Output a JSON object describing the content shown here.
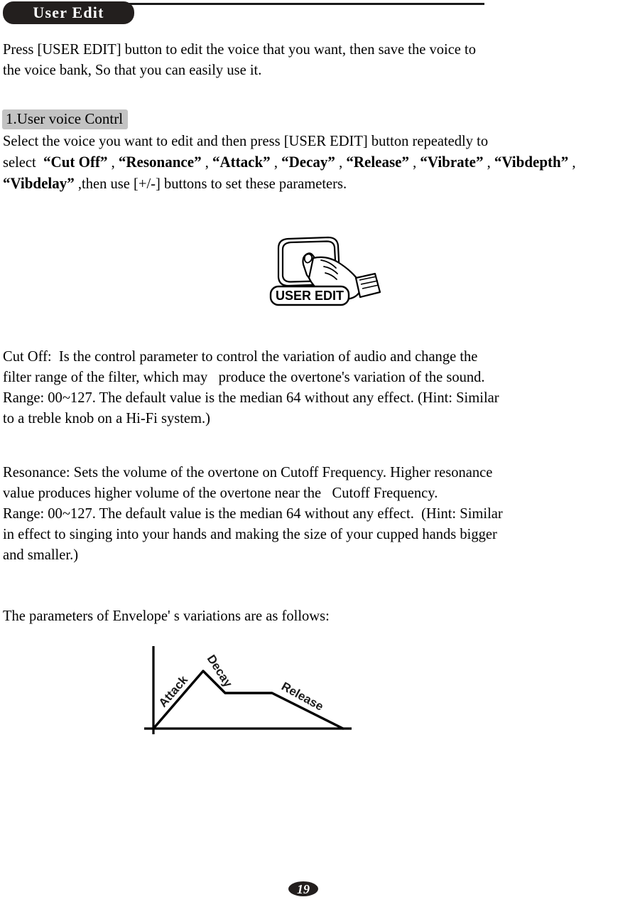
{
  "page": {
    "title_badge": "User Edit",
    "page_number": "19"
  },
  "intro": {
    "paragraph": "Press [USER EDIT] button to edit the voice that you want, then save the voice to\nthe voice bank, So that you can easily use it."
  },
  "section1": {
    "heading": "1.User voice Contrl",
    "line1": "Select the voice you want to edit and then press [USER EDIT] button repeatedly to",
    "line2_prefix": "select  ",
    "parameters": [
      "Cut Off",
      "Resonance",
      "Attack",
      "Decay",
      "Release",
      "Vibrate",
      "Vibdepth",
      "Vibdelay"
    ],
    "line3_suffix": ",then use [+/-] buttons to set these parameters.",
    "quote_open": "“",
    "quote_close": "”",
    "separator": " , "
  },
  "illustration": {
    "button_label": "USER EDIT",
    "alt": "hand pressing the USER EDIT button"
  },
  "cutoff": {
    "text": "Cut Off:  Is the control parameter to control the variation of audio and change the\nfilter range of the filter, which may   produce the overtone's variation of the sound.\nRange: 00~127. The default value is the median 64 without any effect. (Hint: Similar\nto a treble knob on a Hi-Fi system.)"
  },
  "resonance": {
    "text": "Resonance: Sets the volume of the overtone on Cutoff Frequency. Higher resonance\nvalue produces higher volume of the overtone near the   Cutoff Frequency.\nRange: 00~127. The default value is the median 64 without any effect.  (Hint: Similar\nin effect to singing into your hands and making the size of your cupped hands bigger\nand smaller.)"
  },
  "envelope": {
    "intro": "The parameters of Envelope' s variations are as follows:",
    "labels": {
      "attack": "Attack",
      "decay": "Decay",
      "release": "Release"
    }
  },
  "colors": {
    "ink": "#000000",
    "badge_bg": "#231f1e",
    "badge_text": "#ffffff",
    "heading_bg": "#c3c3c3"
  }
}
